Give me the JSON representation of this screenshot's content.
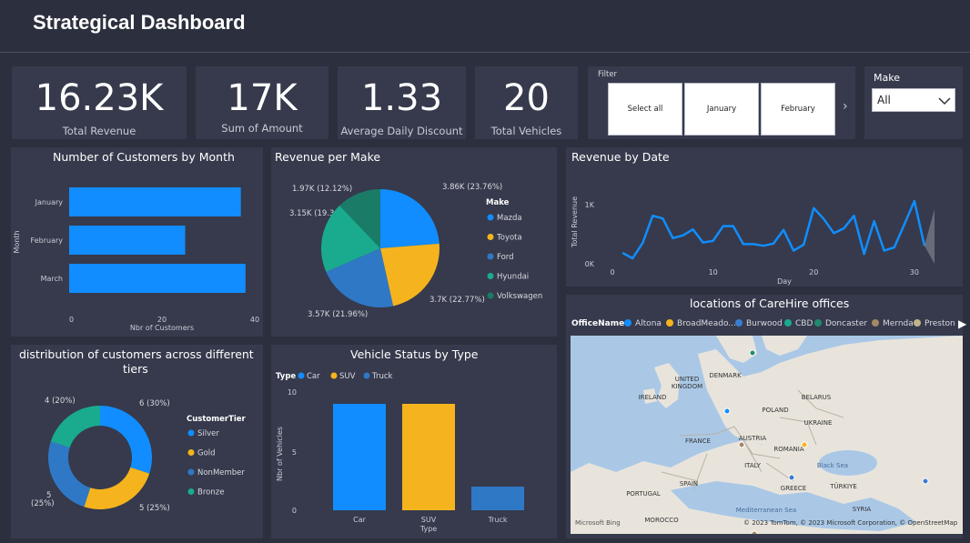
{
  "header": {
    "title": "Strategical Dashboard"
  },
  "kpis": [
    {
      "value": "16.23K",
      "label": "Total Revenue"
    },
    {
      "value": "17K",
      "label": "Sum of Amount"
    },
    {
      "value": "1.33",
      "label": "Average Daily Discount"
    },
    {
      "value": "20",
      "label": "Total Vehicles"
    }
  ],
  "filter": {
    "title": "Filter",
    "buttons": [
      "Select all",
      "January",
      "February"
    ]
  },
  "make_slicer": {
    "title": "Make",
    "selected": "All"
  },
  "customers_by_month": {
    "title": "Number of Customers by Month",
    "ylabel": "Month",
    "xlabel": "Nbr of Customers",
    "ticks": [
      "0",
      "20",
      "40"
    ]
  },
  "revenue_per_make": {
    "title": "Revenue per Make",
    "legend_title": "Make",
    "labels": [
      "3.86K (23.76%)",
      "3.7K (22.77%)",
      "3.57K (21.96%)",
      "3.15K (19.39%)",
      "1.97K (12.12%)"
    ]
  },
  "revenue_by_date": {
    "title": "Revenue by Date",
    "ylabel": "Total Revenue",
    "xlabel": "Day",
    "yticks": [
      "1K",
      "0K"
    ],
    "xticks": [
      "0",
      "10",
      "20",
      "30"
    ]
  },
  "tiers": {
    "title_line1": "distribution of customers across different",
    "title_line2": "tiers",
    "legend_title": "CustomerTier",
    "labels": [
      "6 (30%)",
      "5 (25%)",
      "5",
      "(25%)",
      "4 (20%)"
    ]
  },
  "vehicle_status": {
    "title": "Vehicle Status by Type",
    "legend_title": "Type",
    "ylabel": "Nbr of Vehicles",
    "xlabel": "Type",
    "yticks": [
      "10",
      "5",
      "0"
    ]
  },
  "map": {
    "title": "locations of CareHire offices",
    "legend_title": "OfficeName",
    "offices": [
      {
        "name": "Altona",
        "color": "#118dff"
      },
      {
        "name": "BroadMeado...",
        "color": "#f5b41d"
      },
      {
        "name": "Burwood",
        "color": "#3a7dd0"
      },
      {
        "name": "CBD",
        "color": "#1aab8f"
      },
      {
        "name": "Doncaster",
        "color": "#1f8a70"
      },
      {
        "name": "Mernda",
        "color": "#a68867"
      },
      {
        "name": "Preston",
        "color": "#c3b48a"
      }
    ],
    "places": [
      "UNITED KINGDOM",
      "DENMARK",
      "IRELAND",
      "BELARUS",
      "POLAND",
      "UKRAINE",
      "FRANCE",
      "AUSTRIA",
      "ROMANIA",
      "ITALY",
      "SPAIN",
      "PORTUGAL",
      "GREECE",
      "TÜRKIYE",
      "SYRIA",
      "MOROCCO",
      "Black Sea",
      "Mediterranean Sea"
    ],
    "bing": "Microsoft Bing",
    "copyright": "© 2023 TomTom, © 2023 Microsoft Corporation, © OpenStreetMap"
  },
  "chart_data": [
    {
      "type": "bar",
      "title": "Number of Customers by Month",
      "categories": [
        "January",
        "February",
        "March"
      ],
      "values": [
        37,
        25,
        38
      ],
      "xlabel": "Nbr of Customers",
      "ylabel": "Month",
      "xlim": [
        0,
        40
      ],
      "orientation": "horizontal",
      "color": "#118dff"
    },
    {
      "type": "pie",
      "title": "Revenue per Make",
      "categories": [
        "Mazda",
        "Toyota",
        "Ford",
        "Hyundai",
        "Volkswagen"
      ],
      "values": [
        3.86,
        3.7,
        3.57,
        3.15,
        1.97
      ],
      "percents": [
        23.76,
        22.77,
        21.96,
        19.39,
        12.12
      ],
      "colors": [
        "#118dff",
        "#f5b41d",
        "#2f78c6",
        "#1aab8f",
        "#1a7c66"
      ]
    },
    {
      "type": "line",
      "title": "Revenue by Date",
      "xlabel": "Day",
      "ylabel": "Total Revenue",
      "x": [
        1,
        2,
        3,
        4,
        5,
        6,
        7,
        8,
        9,
        10,
        11,
        12,
        13,
        14,
        15,
        16,
        17,
        18,
        19,
        20,
        21,
        22,
        23,
        24,
        25,
        26,
        27,
        28,
        29,
        30,
        31
      ],
      "y": [
        200,
        100,
        380,
        880,
        830,
        470,
        520,
        630,
        390,
        420,
        690,
        690,
        360,
        360,
        330,
        370,
        620,
        240,
        350,
        1020,
        820,
        560,
        650,
        880,
        180,
        780,
        240,
        300,
        720,
        1150,
        330
      ],
      "ylim": [
        0,
        1300
      ],
      "xlim": [
        -1,
        32
      ],
      "color": "#118dff"
    },
    {
      "type": "pie",
      "title": "distribution of customers across different tiers",
      "categories": [
        "Silver",
        "Gold",
        "NonMember",
        "Bronze"
      ],
      "values": [
        6,
        5,
        5,
        4
      ],
      "percents": [
        30,
        25,
        25,
        20
      ],
      "colors": [
        "#118dff",
        "#f5b41d",
        "#2f78c6",
        "#1aab8f"
      ],
      "donut": true
    },
    {
      "type": "bar",
      "title": "Vehicle Status by Type",
      "categories": [
        "Car",
        "SUV",
        "Truck"
      ],
      "values": [
        9,
        9,
        2
      ],
      "colors": [
        "#118dff",
        "#f5b41d",
        "#2f78c6"
      ],
      "ylim": [
        0,
        10
      ],
      "xlabel": "Type",
      "ylabel": "Nbr of Vehicles"
    }
  ]
}
